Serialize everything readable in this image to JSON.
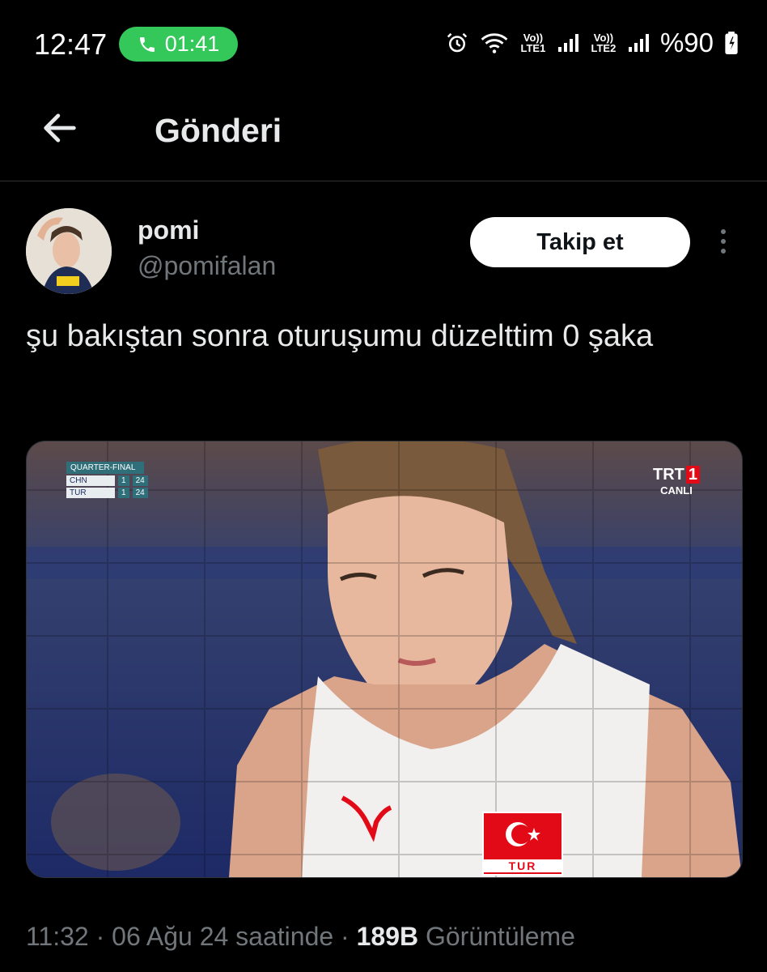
{
  "status_bar": {
    "time": "12:47",
    "call_duration": "01:41",
    "sim1_label": "Vo)) LTE1",
    "sim2_label": "Vo)) LTE2",
    "battery": "%90"
  },
  "header": {
    "title": "Gönderi"
  },
  "post": {
    "display_name": "pomi",
    "handle": "@pomifalan",
    "follow_label": "Takip et",
    "text": "şu bakıştan sonra oturuşumu düzelttim 0 şaka",
    "media": {
      "scoreboard": {
        "stage": "QUARTER-FINAL",
        "rows": [
          {
            "team": "CHN",
            "sets": "1",
            "points": "24"
          },
          {
            "team": "TUR",
            "sets": "1",
            "points": "24"
          }
        ]
      },
      "channel": "TRT",
      "channel_number": "1",
      "channel_sub": "CANLI",
      "jersey_label": "TUR"
    },
    "meta": {
      "time": "11:32",
      "date": "06 Ağu 24 saatinde",
      "views": "189B",
      "views_label": "Görüntüleme"
    }
  },
  "colors": {
    "background": "#000000",
    "text_primary": "#e7e9ea",
    "text_secondary": "#71767b",
    "call_pill": "#34c759",
    "divider": "#2f3336"
  },
  "icons": [
    "phone-icon",
    "alarm-icon",
    "wifi-icon",
    "signal-icon",
    "battery-icon",
    "back-arrow-icon",
    "more-vertical-icon"
  ]
}
